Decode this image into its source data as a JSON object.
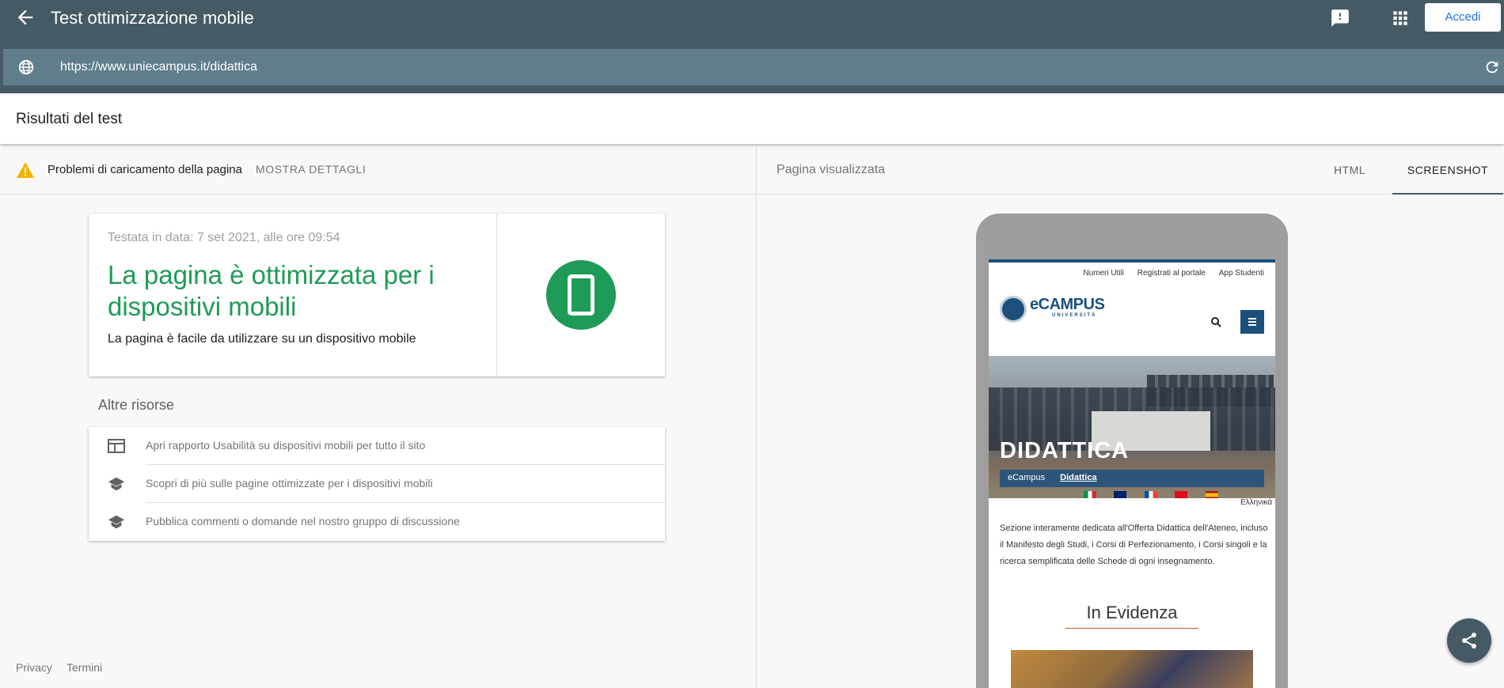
{
  "appbar": {
    "title": "Test ottimizzazione mobile",
    "signin_label": "Accedi",
    "url": "https://www.uniecampus.it/didattica"
  },
  "results": {
    "title": "Risultati del test",
    "warning_text": "Problemi di caricamento della pagina",
    "details_link": "MOSTRA DETTAGLI",
    "tested_on": "Testata in data: 7 set 2021, alle ore 09:54",
    "headline": "La pagina è ottimizzata per i dispositivi mobili",
    "subtext": "La pagina è facile da utilizzare su un dispositivo mobile",
    "status_color": "#1e9b57"
  },
  "resources": {
    "title": "Altre risorse",
    "items": [
      {
        "label": "Apri rapporto Usabilità su dispositivi mobili per tutto il sito",
        "icon": "report-icon"
      },
      {
        "label": "Scopri di più sulle pagine ottimizzate per i dispositivi mobili",
        "icon": "school-icon"
      },
      {
        "label": "Pubblica commenti o domande nel nostro gruppo di discussione",
        "icon": "school-icon"
      }
    ]
  },
  "footer": {
    "privacy": "Privacy",
    "terms": "Termini"
  },
  "preview": {
    "title": "Pagina visualizzata",
    "tabs": [
      {
        "label": "HTML",
        "active": false
      },
      {
        "label": "SCREENSHOT",
        "active": true
      }
    ],
    "site": {
      "top_links": [
        "Numeri Utili",
        "Registrati al portale",
        "App Studenti"
      ],
      "logo_text": "eCAMPUS",
      "logo_sub": "UNIVERSITÀ",
      "hero_title": "DIDATTICA",
      "breadcrumb_home": "eCampus",
      "breadcrumb_current": "Didattica",
      "greek": "Ελληνικά",
      "intro": "Sezione interamente dedicata all'Offerta Didattica dell'Ateneo, incluso il Manifesto degli Studi, i Corsi di Perfezionamento, i Corsi singoli e la ricerca semplificata delle Schede di ogni insegnamento.",
      "section_title": "In Evidenza"
    }
  },
  "colors": {
    "appbar": "#455a64",
    "urlbar": "#607d8b",
    "warning": "#f4b400",
    "brand": "#1d4f7c"
  }
}
